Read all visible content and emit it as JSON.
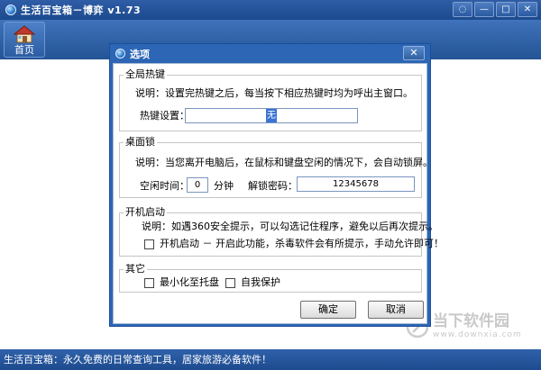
{
  "app": {
    "title": "生活百宝箱－博弈 v1.73",
    "controls": [
      "◌",
      "—",
      "□",
      "✕"
    ]
  },
  "toolbar": {
    "home_label": "首页"
  },
  "statusbar": {
    "text": "生活百宝箱：永久免费的日常查询工具，居家旅游必备软件！"
  },
  "watermark": {
    "name": "当下软件园",
    "url": "www.downxia.com"
  },
  "dialog": {
    "title": "选项",
    "close": "✕",
    "hotkey": {
      "title": "全局热键",
      "desc": "说明：设置完热键之后，每当按下相应热键时均为呼出主窗口。",
      "label": "热键设置：",
      "value": "无"
    },
    "lock": {
      "title": "桌面锁",
      "desc": "说明：当您离开电脑后，在鼠标和键盘空闲的情况下，会自动锁屏。",
      "idle_label": "空闲时间：",
      "idle_value": "0",
      "idle_unit": "分钟",
      "pwd_label": "解锁密码：",
      "pwd_value": "12345678"
    },
    "startup": {
      "title": "开机启动",
      "desc": "说明：如遇360安全提示，可以勾选记住程序，避免以后再次提示。",
      "check_label": "开机启动 － 开启此功能，杀毒软件会有所提示，手动允许即可！"
    },
    "other": {
      "title": "其它",
      "minimize_label": "最小化至托盘",
      "protect_label": "自我保护"
    },
    "ok": "确定",
    "cancel": "取消"
  },
  "colors": {
    "accent": "#2c66b4",
    "titlebar": "#1c4a8e"
  }
}
